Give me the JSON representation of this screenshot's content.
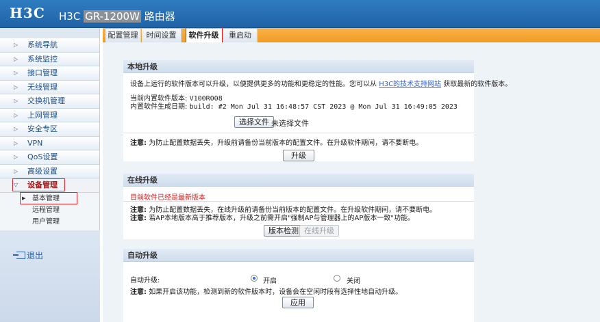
{
  "header": {
    "logo": "H3C",
    "brand": "H3C",
    "model": "GR-1200W",
    "suffix": "路由器"
  },
  "tabs": [
    {
      "label": "配置管理",
      "active": false
    },
    {
      "label": "时间设置",
      "active": false
    },
    {
      "label": "软件升级",
      "active": true
    },
    {
      "label": "重启动",
      "active": false
    }
  ],
  "sidebar": {
    "items": [
      {
        "label": "系统导航"
      },
      {
        "label": "系统监控"
      },
      {
        "label": "接口管理"
      },
      {
        "label": "无线管理"
      },
      {
        "label": "交换机管理"
      },
      {
        "label": "上网管理"
      },
      {
        "label": "安全专区"
      },
      {
        "label": "VPN"
      },
      {
        "label": "QoS设置"
      },
      {
        "label": "高级设置"
      },
      {
        "label": "设备管理",
        "open": true
      }
    ],
    "sub_items": [
      {
        "label": "基本管理",
        "active": true
      },
      {
        "label": "远程管理"
      },
      {
        "label": "用户管理"
      }
    ],
    "logout": "退出"
  },
  "local_upgrade": {
    "title": "本地升级",
    "desc_prefix": "设备上运行的软件版本可以升级，以便提供更多的功能和更稳定的性能。您可以从",
    "desc_link": "H3C的技术支持网站",
    "desc_suffix": "获取最新的软件版本。",
    "version_label": "当前内置软件版本:",
    "version_value": "V100R008",
    "build_label": "内置软件生成日期:",
    "build_value": "build: #2 Mon Jul 31 16:48:57 CST 2023 @ Mon Jul 31 16:49:05 2023",
    "choose_file_btn": "选择文件",
    "no_file_text": "未选择文件",
    "note_label": "注意:",
    "note_text": "为防止配置数据丢失，升级前请备份当前版本的配置文件。在升级软件期间，请不要断电。",
    "upgrade_btn": "升级"
  },
  "online_upgrade": {
    "title": "在线升级",
    "status": "目前软件已经是最新版本",
    "note1_label": "注意:",
    "note1_text": "为防止配置数据丢失，在线升级前请备份当前版本的配置文件。在升级软件期间，请不要断电。",
    "note2_label": "注意:",
    "note2_text": "若AP本地版本高于推荐版本，升级之前需开启\"强制AP与管理器上的AP版本一致\"功能。",
    "check_btn": "版本检测",
    "online_btn": "在线升级"
  },
  "auto_upgrade": {
    "title": "自动升级",
    "label": "自动升级:",
    "on_label": "开启",
    "off_label": "关闭",
    "selected": "开启",
    "note_label": "注意:",
    "note_text": "如果开启该功能，检测到新的软件版本时，设备会在空闲时段有选择性地自动升级。",
    "apply_btn": "应用"
  },
  "colors": {
    "header_blue": "#1f63a6",
    "tab_orange": "#f19c22",
    "highlight_red": "#e0262b"
  }
}
